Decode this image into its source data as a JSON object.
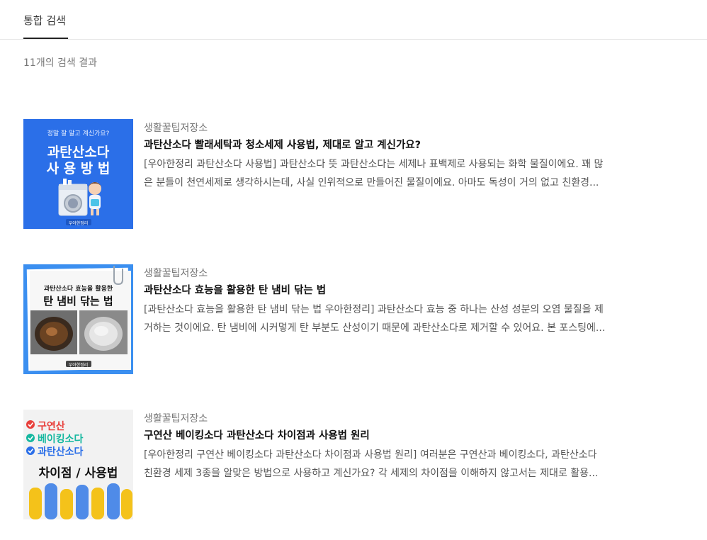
{
  "tabs": {
    "active_label": "통합 검색"
  },
  "search": {
    "result_count": "11개의 검색 결과"
  },
  "results": [
    {
      "category": "생활꿀팁저장소",
      "title": "과탄산소다 빨래세탁과 청소세제 사용법, 제대로 알고 계신가요?",
      "desc_line1": "[우아한정리 과탄산소다 사용법] 과탄산소다 뜻 과탄산소다는 세제나 표백제로 사용되는 화학 물질이에요. 꽤 많",
      "desc_line2": "은 분들이 천연세제로 생각하시는데, 사실 인위적으로 만들어진 물질이에요. 아마도 독성이 거의 없고 친환경...",
      "thumb": {
        "subtitle": "정말 잘 알고 계신가요?",
        "line1": "과탄산소다",
        "line2": "사 용 방 법",
        "brand": "우아한정리",
        "bg": "#2b6fe8"
      }
    },
    {
      "category": "생활꿀팁저장소",
      "title": "과탄산소다 효능을 활용한 탄 냄비 닦는 법",
      "desc_line1": "[과탄산소다 효능을 활용한 탄 냄비 닦는 법 우아한정리] 과탄산소다 효능 중 하나는 산성 성분의 오염 물질을 제",
      "desc_line2": "거하는 것이에요. 탄 냄비에 시커멓게 탄 부분도 산성이기 때문에 과탄산소다로 제거할 수 있어요. 본 포스팅에...",
      "thumb": {
        "line1": "과탄산소다 효능을 활용한",
        "line2": "탄 냄비 닦는 법",
        "brand": "우아한정리",
        "bg": "#3b8ff0"
      }
    },
    {
      "category": "생활꿀팁저장소",
      "title": "구연산 베이킹소다 과탄산소다 차이점과 사용법 원리",
      "desc_line1": "[우아한정리 구연산 베이킹소다 과탄산소다 차이점과 사용법 원리] 여러분은 구연산과 베이킹소다, 과탄산소다",
      "desc_line2": "친환경 세제 3종을 알맞은 방법으로 사용하고 계신가요? 각 세제의 차이점을 이해하지 않고서는 제대로 활용...",
      "thumb": {
        "check1": "구연산",
        "check2": "베이킹소다",
        "check3": "과탄산소다",
        "bottom": "차이점 / 사용법",
        "color1": "#e8403c",
        "color2": "#16b8a0",
        "color3": "#2b6fe8"
      }
    }
  ]
}
